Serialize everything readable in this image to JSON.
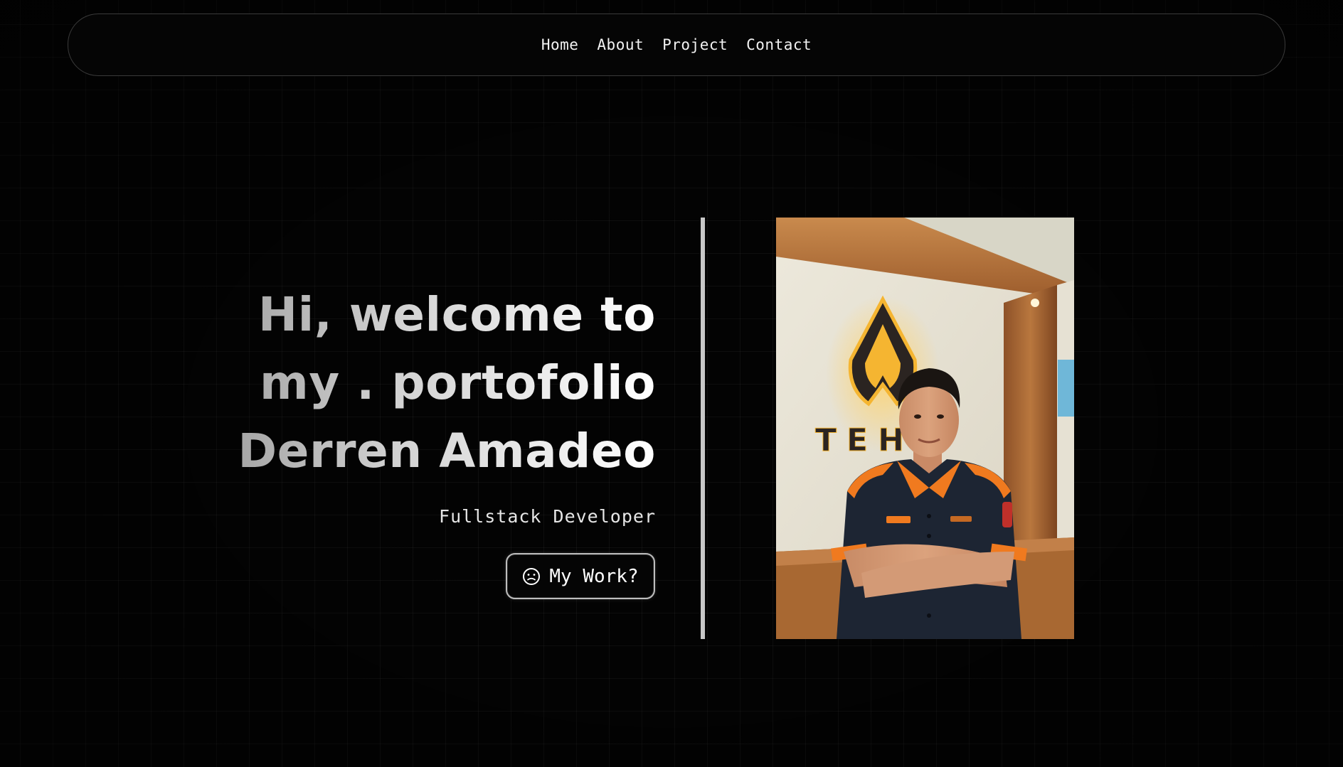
{
  "nav": {
    "items": [
      {
        "label": "Home"
      },
      {
        "label": "About"
      },
      {
        "label": "Project"
      },
      {
        "label": "Contact"
      }
    ]
  },
  "hero": {
    "lines": [
      "Hi, welcome to",
      "my . portofolio",
      "Derren Amadeo"
    ],
    "role": "Fullstack Developer",
    "button": {
      "label": "My Work?",
      "icon": "smiley-icon"
    }
  },
  "photo": {
    "sign_text": "TEH",
    "colors": {
      "wall": "#e8e4d6",
      "wood": "#b06f3a",
      "logo_glow": "#f5b531",
      "shirt": "#1d2533",
      "shirt_accent": "#f07a1f"
    }
  },
  "colors": {
    "background": "#030303",
    "text": "#f2f2f2",
    "divider": "#c8c8c8"
  }
}
